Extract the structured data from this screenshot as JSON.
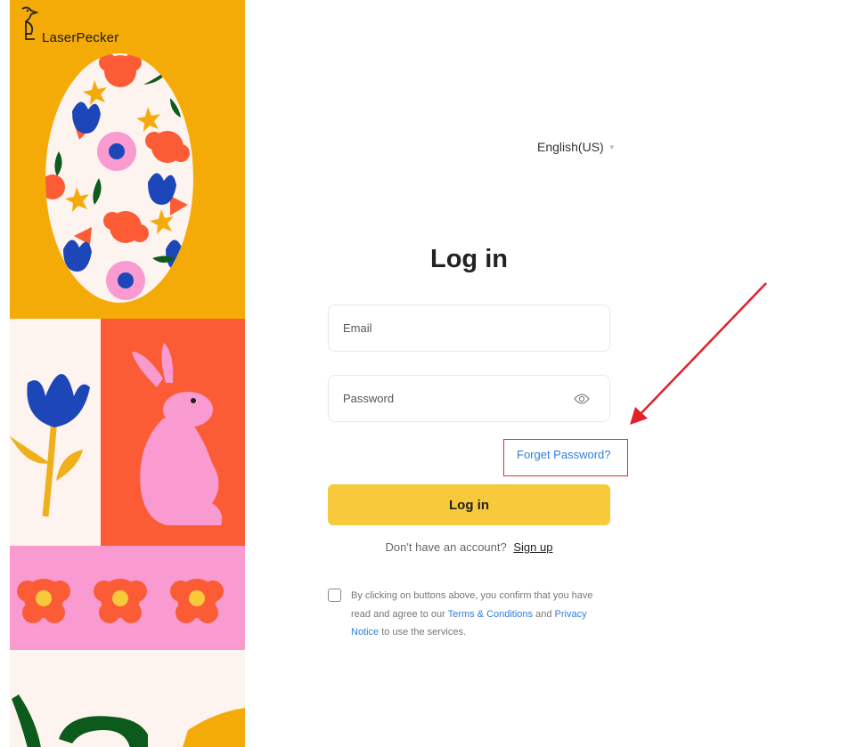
{
  "brand": {
    "name": "LaserPecker"
  },
  "language": {
    "label": "English(US)"
  },
  "login": {
    "title": "Log in",
    "email_placeholder": "Email",
    "password_placeholder": "Password",
    "forgot_label": "Forget Password?",
    "button_label": "Log in"
  },
  "signup": {
    "prompt": "Don't have an account?",
    "link_label": "Sign up"
  },
  "consent": {
    "text_before": "By clicking on buttons above, you confirm that you have read and agree to our",
    "terms_label": "Terms & Conditions",
    "and": "and",
    "privacy_label": "Privacy Notice",
    "text_after": "to use the services."
  },
  "icons": {
    "eye": "eye-icon",
    "logo": "woodpecker-logo-icon",
    "caret": "caret-down-icon"
  },
  "colors": {
    "accent_yellow": "#f8c93a",
    "link_blue": "#2f7de1",
    "annotation_red": "#d9303a",
    "panel_orange": "#f5ab07",
    "panel_coral": "#fb5c36",
    "panel_pink": "#f99ad0"
  }
}
